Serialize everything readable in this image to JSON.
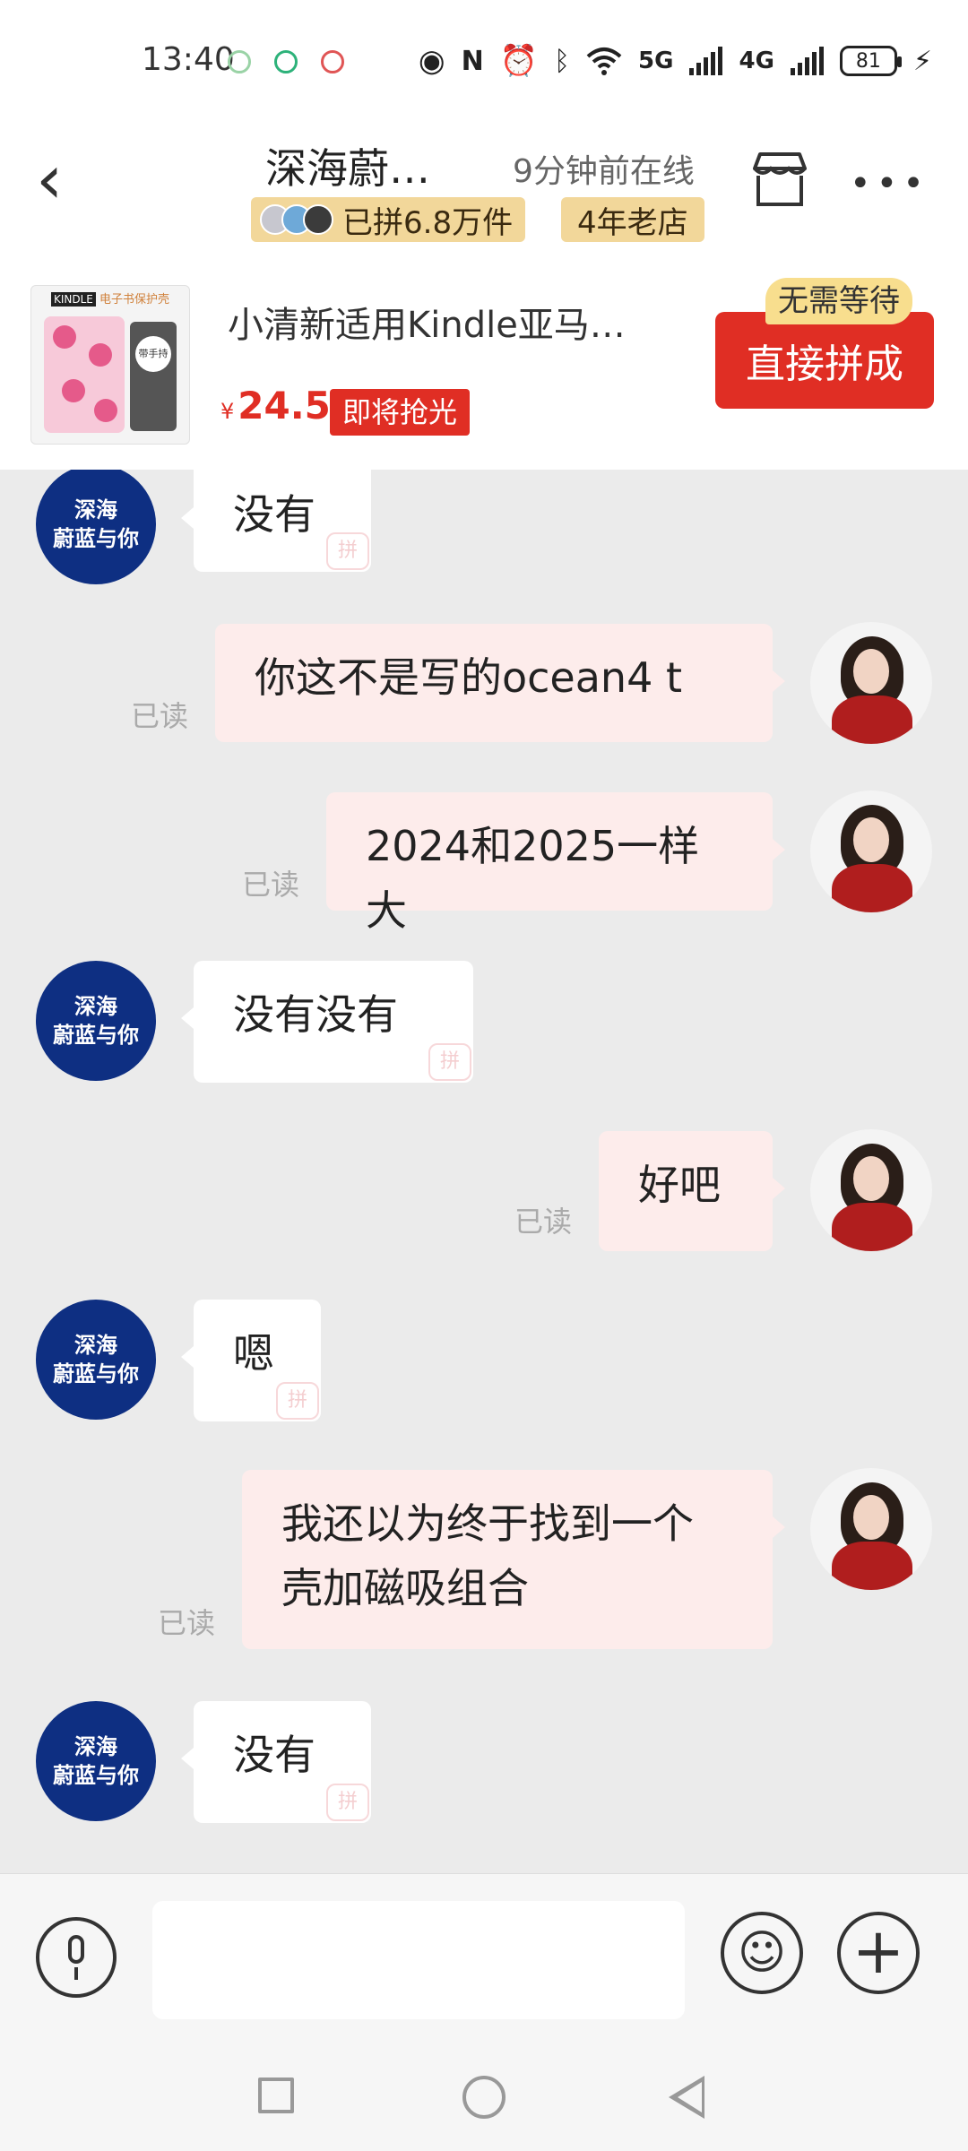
{
  "status_bar": {
    "time": "13:40",
    "network_5g": "5G",
    "network_4g": "4G",
    "battery": "81"
  },
  "header": {
    "shop_name": "深海蔚…",
    "online_status": "9分钟前在线",
    "sold_badge": "已拼6.8万件",
    "shop_age_badge": "4年老店"
  },
  "product": {
    "thumb_brand": "KINDLE",
    "thumb_title": "电子书保护壳",
    "thumb_handle": "带手持",
    "title": "小清新适用Kindle亚马…",
    "price_symbol": "¥",
    "price": "24.5",
    "price_tag": "即将抢光",
    "buy_button": "直接拼成",
    "buy_badge": "无需等待"
  },
  "chat": {
    "shop_avatar_line1": "深海",
    "shop_avatar_line2": "蔚蓝与你",
    "read_label": "已读",
    "pin_mark": "拼",
    "messages": [
      {
        "from": "shop",
        "text": "没有"
      },
      {
        "from": "user",
        "text": "你这不是写的ocean4 t"
      },
      {
        "from": "user",
        "text": "2024和2025一样大"
      },
      {
        "from": "shop",
        "text": "没有没有"
      },
      {
        "from": "user",
        "text": "好吧"
      },
      {
        "from": "shop",
        "text": "嗯"
      },
      {
        "from": "user",
        "text": "我还以为终于找到一个壳加磁吸组合"
      },
      {
        "from": "shop",
        "text": "没有"
      }
    ]
  },
  "input_bar": {
    "placeholder": ""
  },
  "icons": {
    "back": "chevron-left-icon",
    "store": "store-icon",
    "more": "more-icon",
    "mic": "microphone-icon",
    "emoji": "emoji-icon",
    "plus": "plus-icon"
  },
  "colors": {
    "accent_red": "#e02e24",
    "badge_gold": "#f2d79a",
    "shop_avatar_bg": "#0e2f82",
    "user_bubble": "#fdeceb"
  }
}
